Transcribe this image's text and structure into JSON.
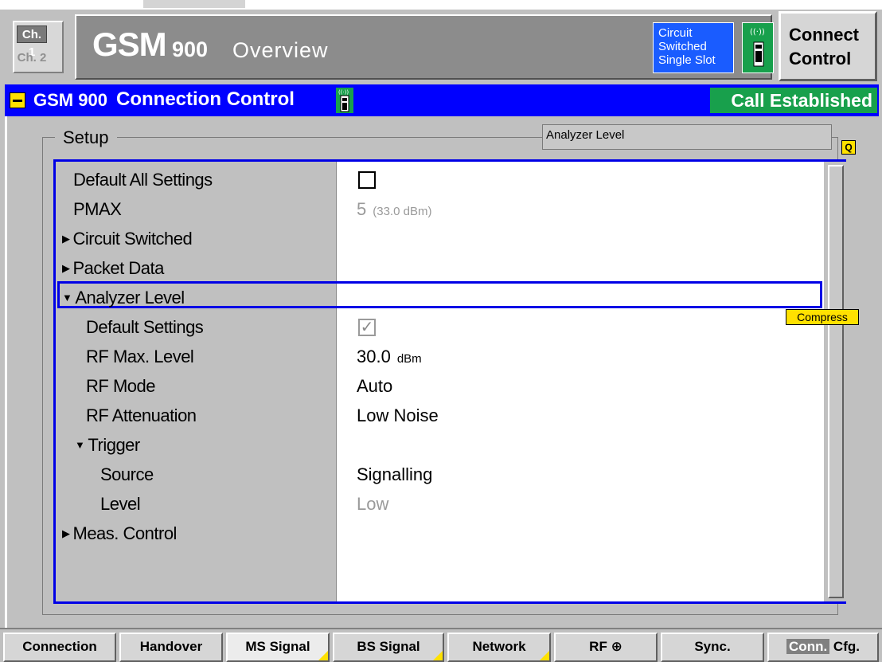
{
  "header": {
    "channel_1": "Ch. 1",
    "channel_2": "Ch. 2",
    "title_main": "GSM",
    "title_band": "900",
    "title_sub": "Overview",
    "mode_line1": "Circuit",
    "mode_line2": "Switched",
    "mode_line3": "Single Slot",
    "connect_line1": "Connect",
    "connect_line2": "Control"
  },
  "titlebar": {
    "band": "GSM 900",
    "title": "Connection Control",
    "status": "Call Established"
  },
  "setup": {
    "legend": "Setup",
    "info_field": "Analyzer Level",
    "q_icon": "Q",
    "compress": "Compress"
  },
  "rows": [
    {
      "label": "Default All Settings",
      "value": ""
    },
    {
      "label": "PMAX",
      "value": "5",
      "unit": "(33.0 dBm)"
    },
    {
      "label": "Circuit Switched",
      "value": ""
    },
    {
      "label": "Packet Data",
      "value": ""
    },
    {
      "label": "Analyzer Level",
      "value": ""
    },
    {
      "label": "Default Settings",
      "value": ""
    },
    {
      "label": "RF Max. Level",
      "value": "30.0",
      "unit": "dBm"
    },
    {
      "label": "RF Mode",
      "value": "Auto"
    },
    {
      "label": "RF Attenuation",
      "value": "Low Noise"
    },
    {
      "label": "Trigger",
      "value": ""
    },
    {
      "label": "Source",
      "value": "Signalling"
    },
    {
      "label": "Level",
      "value": "Low"
    },
    {
      "label": "Meas. Control",
      "value": ""
    }
  ],
  "softkeys": {
    "connection": "Connection",
    "handover": "Handover",
    "ms_signal": "MS Signal",
    "bs_signal": "BS Signal",
    "network": "Network",
    "rf": "RF",
    "sync": "Sync.",
    "conn": "Conn.",
    "cfg": "Cfg."
  },
  "colors": {
    "title_bar": "#0000ff",
    "status_green": "#18a04c",
    "mode_blue": "#1a5cff",
    "highlight_yellow": "#ffe100"
  }
}
